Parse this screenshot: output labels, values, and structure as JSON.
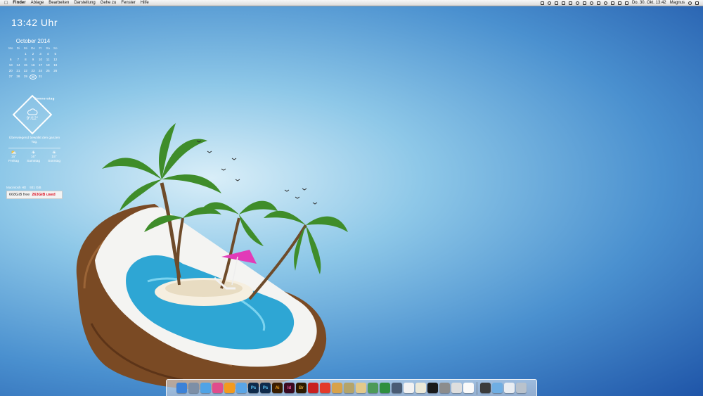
{
  "menubar": {
    "app_name": "Finder",
    "menus": [
      "Ablage",
      "Bearbeiten",
      "Darstellung",
      "Gehe zu",
      "Fenster",
      "Hilfe"
    ],
    "datetime": "Do. 30. Okt. 13:42",
    "user": "Magnus"
  },
  "clock": {
    "time": "13:42 Uhr"
  },
  "calendar": {
    "title": "October 2014",
    "weekdays": [
      "Mo",
      "Di",
      "Mi",
      "Do",
      "Fr",
      "Sa",
      "So"
    ],
    "leading_blanks": 2,
    "days": [
      "1",
      "2",
      "3",
      "4",
      "5",
      "6",
      "7",
      "8",
      "9",
      "10",
      "11",
      "12",
      "13",
      "14",
      "15",
      "16",
      "17",
      "18",
      "19",
      "20",
      "21",
      "22",
      "23",
      "24",
      "25",
      "26",
      "27",
      "28",
      "29",
      "30",
      "31"
    ],
    "today": "30"
  },
  "weather": {
    "day": "Donnerstag",
    "temp": "9°/12°",
    "description": "Überwiegend bewölkt den ganzen Tag.",
    "forecast": [
      {
        "temp": "15°",
        "day": "Freitag",
        "icon": "partly-cloudy-icon"
      },
      {
        "temp": "16°",
        "day": "Samstag",
        "icon": "sun-icon"
      },
      {
        "temp": "15°",
        "day": "Sonntag",
        "icon": "sun-icon"
      }
    ]
  },
  "disk": {
    "name": "Macintosh HD",
    "total": "931 GiB",
    "free": "668GiB free",
    "used": "263GiB used"
  },
  "colors": {
    "menubar": "#e6e6e6",
    "disk_used": "#dd1122",
    "sky_dark": "#1f55a8",
    "sky_light": "#d9eef8"
  },
  "dock": {
    "apps": [
      {
        "name": "finder-icon",
        "label": "",
        "bg": "#3c82d8",
        "fg": "#fff"
      },
      {
        "name": "launchpad-icon",
        "label": "",
        "bg": "#7d8fa6",
        "fg": "#fff"
      },
      {
        "name": "safari-icon",
        "label": "",
        "bg": "#4fa3e6",
        "fg": "#fff"
      },
      {
        "name": "itunes-icon",
        "label": "",
        "bg": "#e04d8c",
        "fg": "#fff"
      },
      {
        "name": "vlc-icon",
        "label": "",
        "bg": "#f39a1d",
        "fg": "#fff"
      },
      {
        "name": "mail-icon",
        "label": "",
        "bg": "#5aa5e6",
        "fg": "#fff"
      },
      {
        "name": "photoshop-icon",
        "label": "Ps",
        "bg": "#0e2a4a",
        "fg": "#5cc6f6"
      },
      {
        "name": "photoshop-2-icon",
        "label": "Ps",
        "bg": "#0e2a4a",
        "fg": "#5cc6f6"
      },
      {
        "name": "illustrator-icon",
        "label": "Ai",
        "bg": "#3a1d00",
        "fg": "#f7a51c"
      },
      {
        "name": "indesign-icon",
        "label": "Id",
        "bg": "#3a0a20",
        "fg": "#f05a9e"
      },
      {
        "name": "bridge-icon",
        "label": "Br",
        "bg": "#2c1a00",
        "fg": "#d9a33d"
      },
      {
        "name": "acrobat-icon",
        "label": "",
        "bg": "#c81f1f",
        "fg": "#fff"
      },
      {
        "name": "acrobat-reader-icon",
        "label": "",
        "bg": "#e33a2a",
        "fg": "#fff"
      },
      {
        "name": "books-icon",
        "label": "",
        "bg": "#d8a24a",
        "fg": "#fff"
      },
      {
        "name": "winrar-icon",
        "label": "",
        "bg": "#b4a46a",
        "fg": "#fff"
      },
      {
        "name": "notes-icon",
        "label": "",
        "bg": "#e3c98a",
        "fg": "#333"
      },
      {
        "name": "utility-icon",
        "label": "",
        "bg": "#4d9a58",
        "fg": "#fff"
      },
      {
        "name": "app-store-icon",
        "label": "",
        "bg": "#2f8f3f",
        "fg": "#fff"
      },
      {
        "name": "camera-icon",
        "label": "",
        "bg": "#4a5c74",
        "fg": "#fff"
      },
      {
        "name": "textedit-icon",
        "label": "",
        "bg": "#f2f2f2",
        "fg": "#333"
      },
      {
        "name": "preview-icon",
        "label": "",
        "bg": "#ece9d8",
        "fg": "#333"
      },
      {
        "name": "terminal-icon",
        "label": "",
        "bg": "#1a1a1a",
        "fg": "#8f8"
      },
      {
        "name": "system-preferences-icon",
        "label": "",
        "bg": "#8c8c8c",
        "fg": "#fff"
      },
      {
        "name": "printer-icon",
        "label": "",
        "bg": "#dedede",
        "fg": "#333"
      },
      {
        "name": "calendar-app-icon",
        "label": "",
        "bg": "#fafafa",
        "fg": "#d22"
      }
    ],
    "folders": [
      {
        "name": "folder-icon",
        "bg": "#3b3b3b"
      },
      {
        "name": "downloads-folder-icon",
        "bg": "#6faee3"
      },
      {
        "name": "drive-icon",
        "bg": "#e9edf2"
      },
      {
        "name": "trash-icon",
        "bg": "#b9c2cc"
      }
    ]
  }
}
